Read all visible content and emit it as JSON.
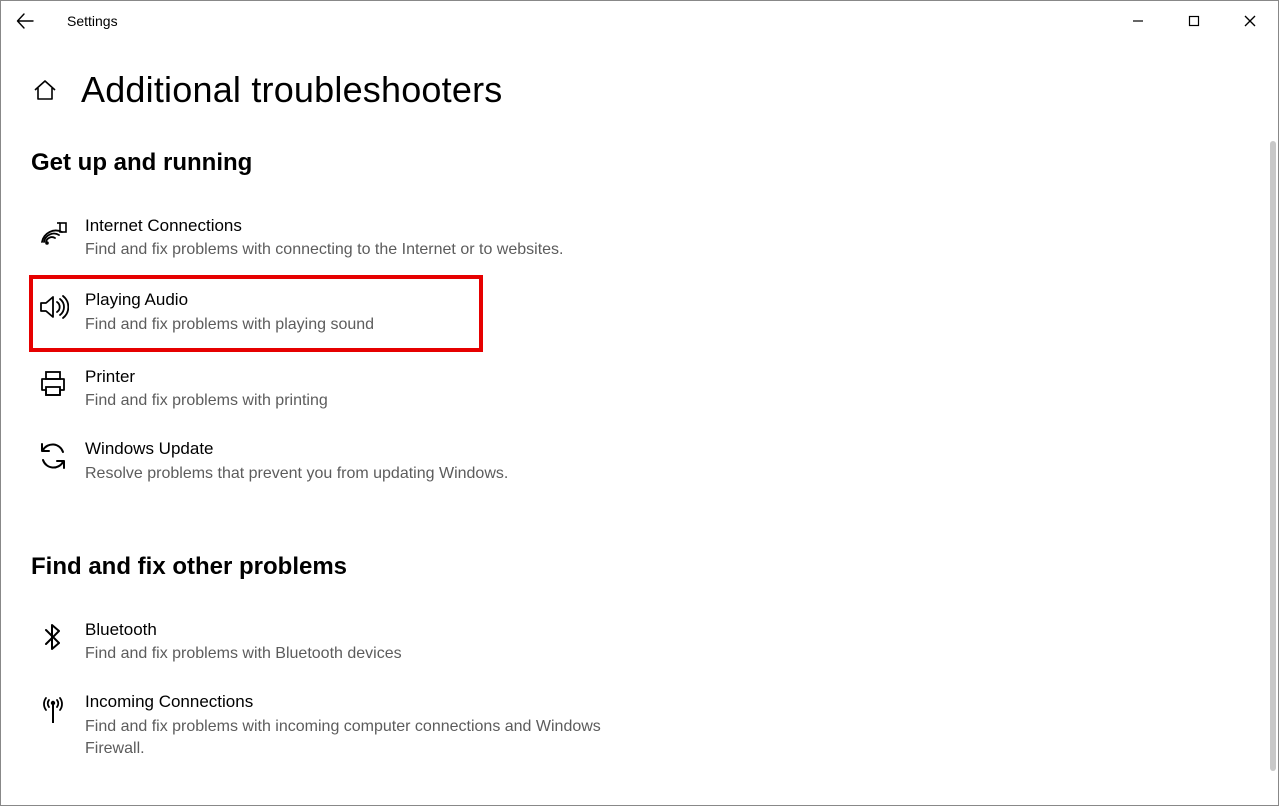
{
  "app": {
    "title": "Settings"
  },
  "page": {
    "title": "Additional troubleshooters"
  },
  "sections": {
    "s1": {
      "title": "Get up and running",
      "items": [
        {
          "title": "Internet Connections",
          "desc": "Find and fix problems with connecting to the Internet or to websites."
        },
        {
          "title": "Playing Audio",
          "desc": "Find and fix problems with playing sound"
        },
        {
          "title": "Printer",
          "desc": "Find and fix problems with printing"
        },
        {
          "title": "Windows Update",
          "desc": "Resolve problems that prevent you from updating Windows."
        }
      ]
    },
    "s2": {
      "title": "Find and fix other problems",
      "items": [
        {
          "title": "Bluetooth",
          "desc": "Find and fix problems with Bluetooth devices"
        },
        {
          "title": "Incoming Connections",
          "desc": "Find and fix problems with incoming computer connections and Windows Firewall."
        }
      ]
    }
  }
}
